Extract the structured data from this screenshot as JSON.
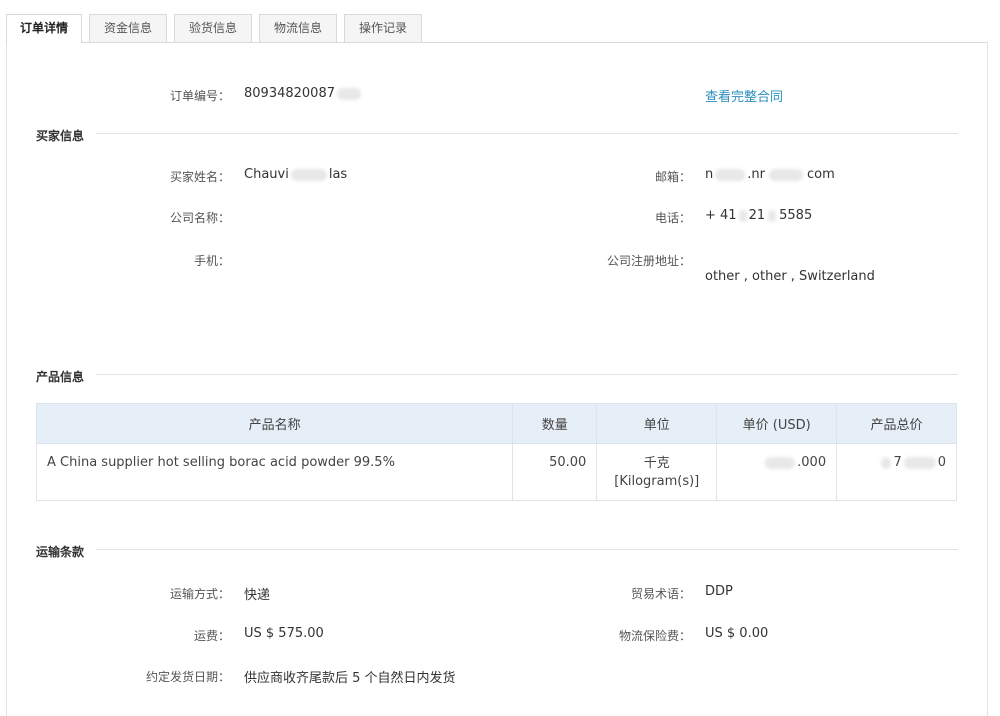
{
  "tabs": [
    {
      "label": "订单详情",
      "active": true
    },
    {
      "label": "资金信息",
      "active": false
    },
    {
      "label": "验货信息",
      "active": false
    },
    {
      "label": "物流信息",
      "active": false
    },
    {
      "label": "操作记录",
      "active": false
    }
  ],
  "order": {
    "number_label": "订单编号：",
    "number_value": "80934820087",
    "contract_link": "查看完整合同"
  },
  "buyer": {
    "section_title": "买家信息",
    "name_label": "买家姓名：",
    "name_part1": "Chauvi",
    "name_part2": "las",
    "email_label": "邮箱：",
    "email_part1": "n",
    "email_part2": ".nr",
    "email_part3": "com",
    "company_label": "公司名称：",
    "phone_label": "电话：",
    "phone_part1": "+ 41",
    "phone_part2": "21",
    "phone_part3": "5585",
    "mobile_label": "手机：",
    "address_label": "公司注册地址：",
    "address_value": "other , other , Switzerland"
  },
  "product": {
    "section_title": "产品信息",
    "columns": [
      "产品名称",
      "数量",
      "单位",
      "单价 (USD)",
      "产品总价"
    ],
    "rows": [
      {
        "name": "A China supplier hot selling borac acid powder 99.5%",
        "quantity": "50.00",
        "unit_line1": "千克",
        "unit_line2": "[Kilogram(s)]",
        "unit_price_visible": ".000",
        "total_visible_a": "7",
        "total_visible_b": "0"
      }
    ]
  },
  "shipping": {
    "section_title": "运输条款",
    "method_label": "运输方式：",
    "method_value": "快递",
    "trade_term_label": "贸易术语：",
    "trade_term_value": "DDP",
    "fee_label": "运费：",
    "fee_value": "US $ 575.00",
    "insurance_label": "物流保险费：",
    "insurance_value": "US $ 0.00",
    "ship_date_label": "约定发货日期：",
    "ship_date_value": "供应商收齐尾款后 5 个自然日内发货"
  }
}
